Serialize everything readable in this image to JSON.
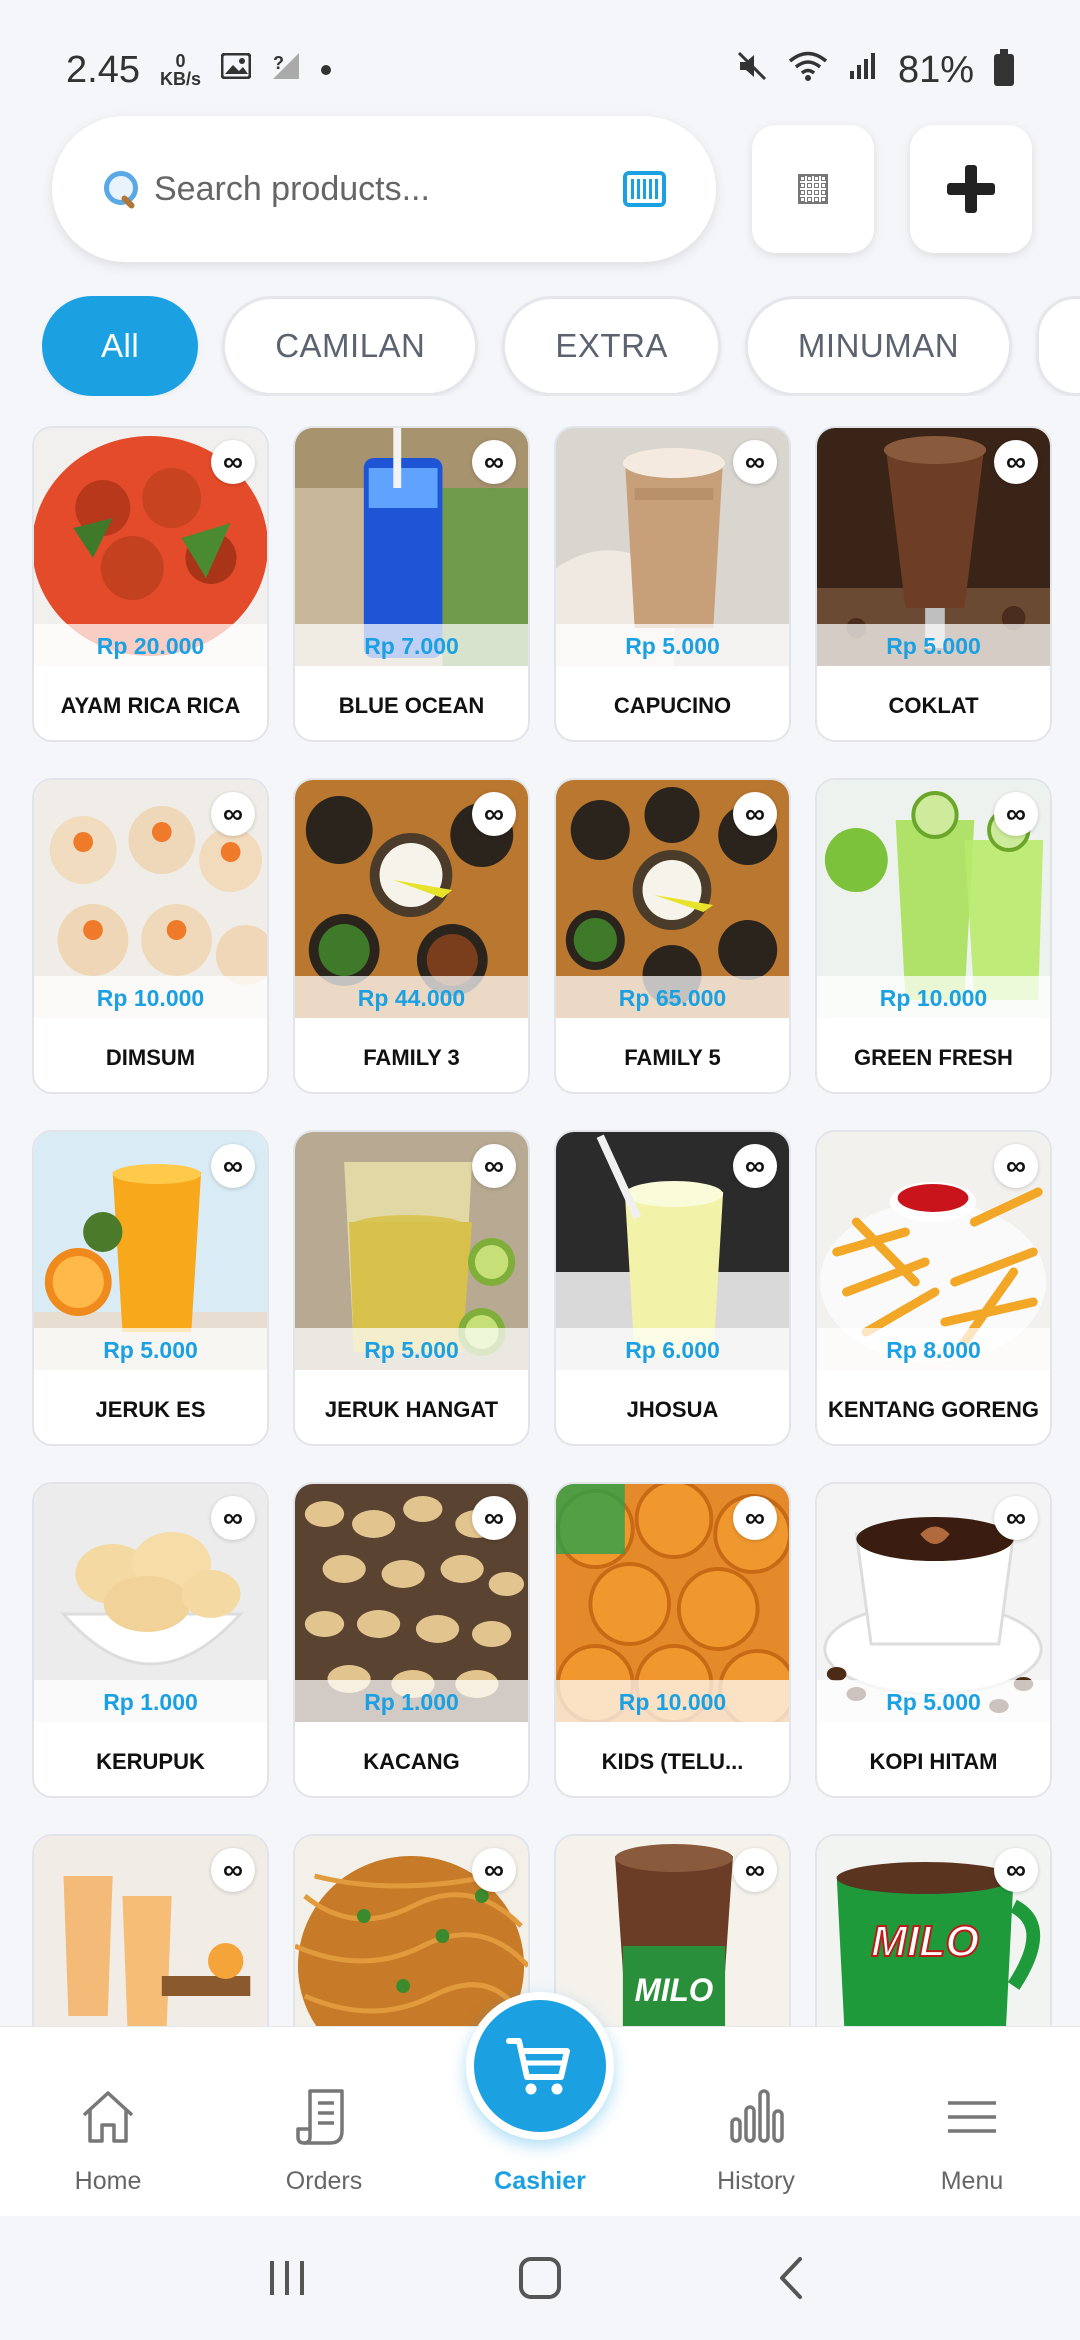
{
  "status_bar": {
    "time": "2.45",
    "net_speed_value": "0",
    "net_speed_unit": "KB/s",
    "battery": "81%"
  },
  "search": {
    "placeholder": "Search products..."
  },
  "categories": [
    "All",
    "CAMILAN",
    "EXTRA",
    "MINUMAN"
  ],
  "stock_symbol": "∞",
  "products": [
    {
      "name": "AYAM RICA RICA",
      "price": "Rp 20.000"
    },
    {
      "name": "BLUE OCEAN",
      "price": "Rp 7.000"
    },
    {
      "name": "CAPUCINO",
      "price": "Rp 5.000"
    },
    {
      "name": "COKLAT",
      "price": "Rp 5.000"
    },
    {
      "name": "DIMSUM",
      "price": "Rp 10.000"
    },
    {
      "name": "FAMILY 3",
      "price": "Rp 44.000"
    },
    {
      "name": "FAMILY 5",
      "price": "Rp 65.000"
    },
    {
      "name": "GREEN FRESH",
      "price": "Rp 10.000"
    },
    {
      "name": "JERUK ES",
      "price": "Rp 5.000"
    },
    {
      "name": "JERUK HANGAT",
      "price": "Rp 5.000"
    },
    {
      "name": "JHOSUA",
      "price": "Rp 6.000"
    },
    {
      "name": "KENTANG GORENG",
      "price": "Rp 8.000"
    },
    {
      "name": "KERUPUK",
      "price": "Rp 1.000"
    },
    {
      "name": "KACANG",
      "price": "Rp 1.000"
    },
    {
      "name": "KIDS (TELU...",
      "price": "Rp 10.000"
    },
    {
      "name": "KOPI HITAM",
      "price": "Rp 5.000"
    }
  ],
  "partial_products_text": [
    "MILO",
    "MILO"
  ],
  "bottom_nav": {
    "home": "Home",
    "orders": "Orders",
    "cashier": "Cashier",
    "history": "History",
    "menu": "Menu"
  },
  "colors": {
    "accent": "#1ba1e2",
    "background": "#f4f6f9"
  }
}
